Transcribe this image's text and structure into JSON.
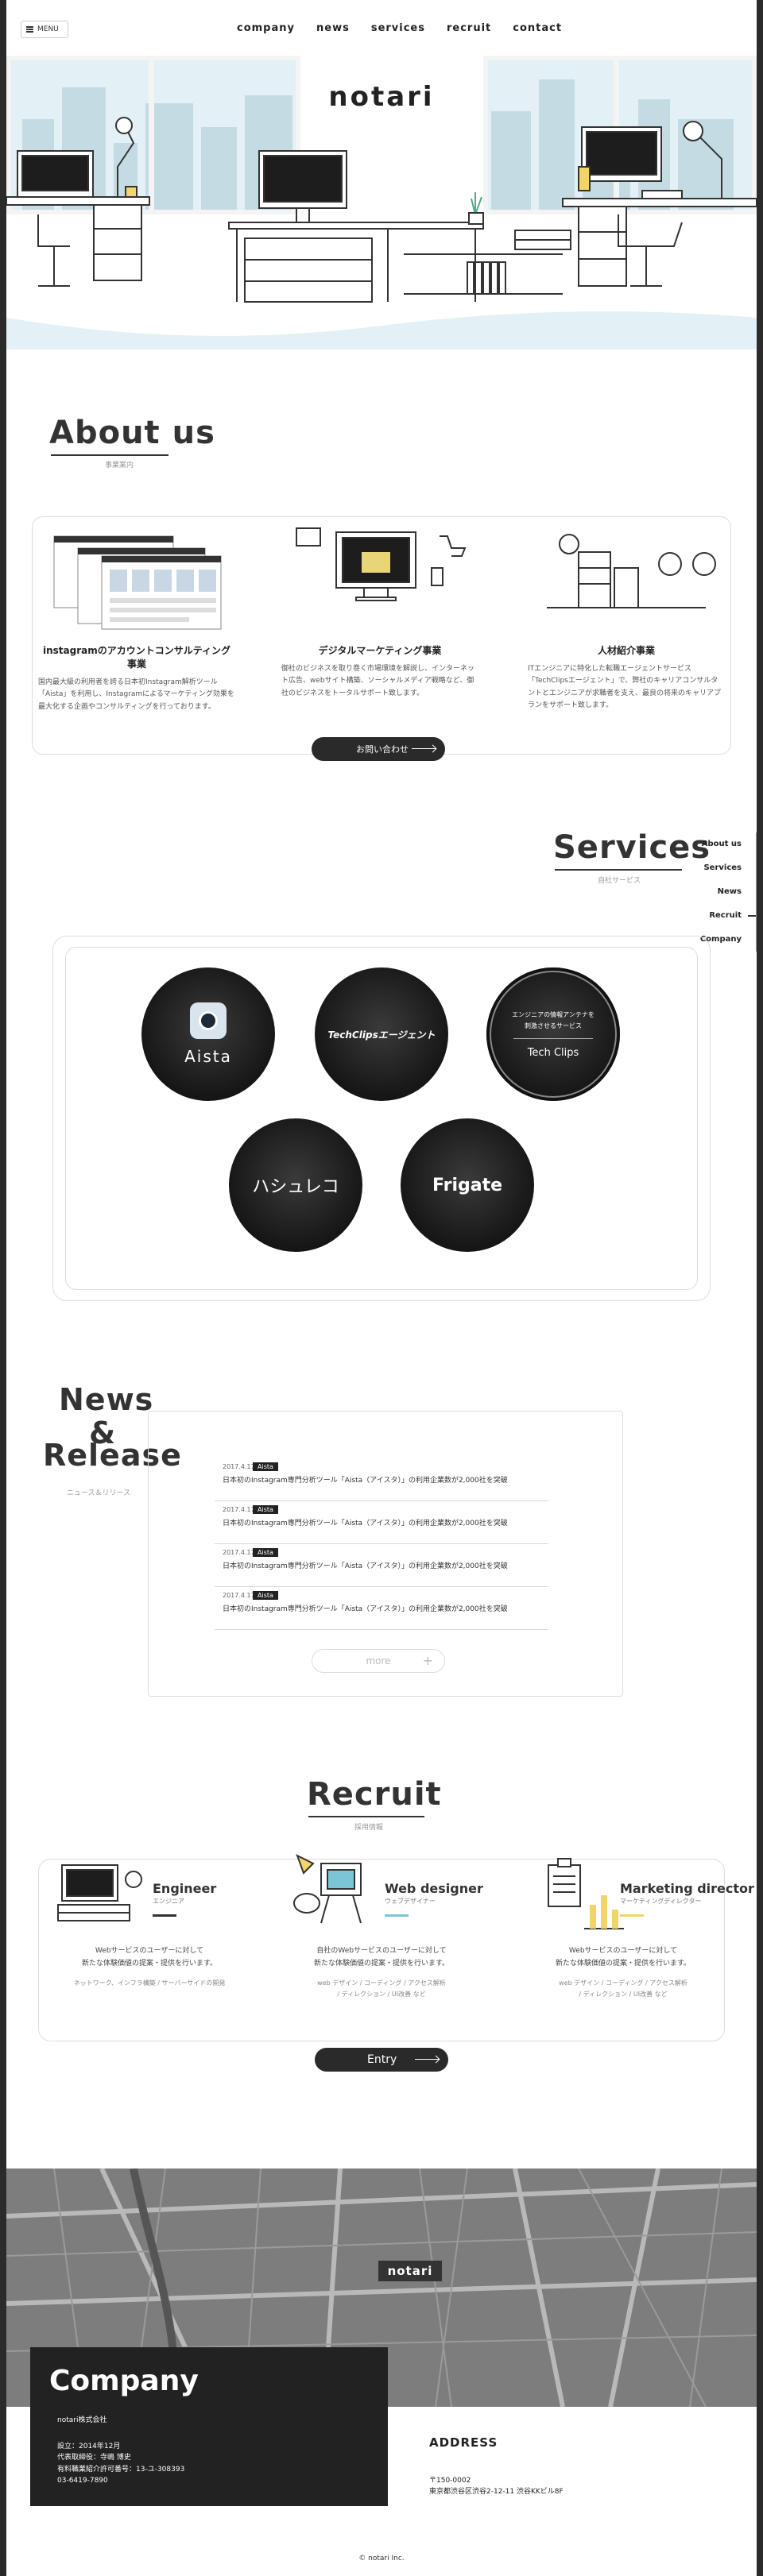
{
  "header": {
    "menu_label": "MENU",
    "nav": [
      "company",
      "news",
      "services",
      "recruit",
      "contact"
    ]
  },
  "hero": {
    "logo": "notari"
  },
  "about": {
    "title": "About us",
    "subtitle": "事業案内",
    "items": [
      {
        "title": "instagramのアカウントコンサルティング事業",
        "text": "国内最大級の利用者を誇る日本初Instagram解析ツール「Aista」を利用し、Instagramによるマーケティング効果を最大化する企画やコンサルティングを行っております。"
      },
      {
        "title": "デジタルマーケティング事業",
        "text": "御社のビジネスを取り巻く市場環境を解説し、インターネット広告、webサイト構築、ソーシャルメディア戦略など、御社のビジネスをトータルサポート致します。"
      },
      {
        "title": "人材紹介事業",
        "text": "ITエンジニアに特化した転職エージェントサービス「TechClipsエージェント」で、弊社のキャリアコンサルタントとエンジニアが求職者を支え、最良の将来のキャリアプランをサポート致します。"
      }
    ],
    "contact_button": "お問い合わせ"
  },
  "side_nav": [
    "About us",
    "Services",
    "News",
    "Recruit",
    "Company"
  ],
  "services": {
    "title": "Services",
    "subtitle": "自社サービス",
    "items": [
      {
        "name": "Aista"
      },
      {
        "name": "TechClipsエージェント"
      },
      {
        "name": "Tech Clips",
        "caption1": "エンジニアの情報アンテナを",
        "caption2": "刺激させるサービス"
      },
      {
        "name": "ハシュレコ"
      },
      {
        "name": "Frigate"
      }
    ]
  },
  "news": {
    "title_1": "News",
    "title_2": "&",
    "title_3": "Release",
    "subtitle": "ニュース＆リリース",
    "items": [
      {
        "date": "2017.4.17",
        "tag": "Aista",
        "text": "日本初のInstagram専門分析ツール「Aista（アイスタ）」の利用企業数が2,000社を突破"
      },
      {
        "date": "2017.4.17",
        "tag": "Aista",
        "text": "日本初のInstagram専門分析ツール「Aista（アイスタ）」の利用企業数が2,000社を突破"
      },
      {
        "date": "2017.4.17",
        "tag": "Aista",
        "text": "日本初のInstagram専門分析ツール「Aista（アイスタ）」の利用企業数が2,000社を突破"
      },
      {
        "date": "2017.4.17",
        "tag": "Aista",
        "text": "日本初のInstagram専門分析ツール「Aista（アイスタ）」の利用企業数が2,000社を突破"
      }
    ],
    "more_button": "more"
  },
  "recruit": {
    "title": "Recruit",
    "subtitle": "採用情報",
    "jobs": [
      {
        "title": "Engineer",
        "sub": "エンジニア",
        "line1": "Webサービスのユーザーに対して",
        "line2": "新たな体験価値の提案・提供を行います。",
        "note1": "ネットワーク、インフラ構築 / サーバーサイドの開発",
        "note2": "",
        "color": "#333333"
      },
      {
        "title": "Web designer",
        "sub": "ウェブデザイナー",
        "line1": "自社のWebサービスのユーザーに対して",
        "line2": "新たな体験価値の提案・提供を行います。",
        "note1": "web デザイン / コーディング / アクセス解析",
        "note2": "/ ディレクション / UI改善 など",
        "color": "#7cc5d6"
      },
      {
        "title": "Marketing director",
        "sub": "マーケティングディレクター",
        "line1": "Webサービスのユーザーに対して",
        "line2": "新たな体験価値の提案・提供を行います。",
        "note1": "web デザイン / コーディング / アクセス解析",
        "note2": "/ ディレクション / UI改善 など",
        "color": "#f2d46b"
      }
    ],
    "entry_button": "Entry"
  },
  "map": {
    "pin_label": "notari"
  },
  "company": {
    "title": "Company",
    "name": "notari株式会社",
    "founded": "設立：2014年12月",
    "representative": "代表取締役：寺嶋 博史",
    "license": "有料職業紹介許可番号：13-ユ-308393",
    "tel": "03-6419-7890"
  },
  "address": {
    "title": "ADDRESS",
    "zip": "〒150-0002",
    "line": "東京都渋谷区渋谷2-12-11 渋谷KKビル8F"
  },
  "footer": {
    "copyright": "© notari Inc."
  },
  "colors": {
    "accent_dark": "#222222",
    "accent_blue": "#7cc5d6",
    "accent_yellow": "#f2d46b"
  }
}
